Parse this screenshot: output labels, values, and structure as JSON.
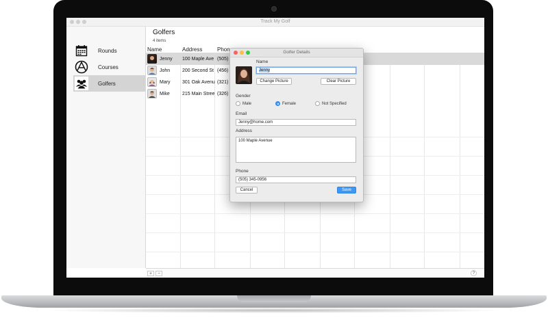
{
  "window": {
    "title": "Track My Golf"
  },
  "sidebar": {
    "items": [
      {
        "label": "Rounds",
        "icon": "calendar-icon",
        "selected": false
      },
      {
        "label": "Courses",
        "icon": "globe-icon",
        "selected": false
      },
      {
        "label": "Golfers",
        "icon": "people-icon",
        "selected": true
      }
    ]
  },
  "main": {
    "title": "Golfers",
    "subtitle": "4 items",
    "columns": [
      "Name",
      "Address",
      "Phon"
    ],
    "rows": [
      {
        "name": "Jenny",
        "address": "100 Maple Ave",
        "phone": "(505)",
        "selected": true
      },
      {
        "name": "John",
        "address": "200 Second St",
        "phone": "(456)",
        "selected": false
      },
      {
        "name": "Mary",
        "address": "301 Oak Avenu",
        "phone": "(321)",
        "selected": false
      },
      {
        "name": "Mike",
        "address": "215 Main Stree",
        "phone": "(326)",
        "selected": false
      }
    ],
    "add_button": "+",
    "remove_button": "−",
    "help_button": "?"
  },
  "dialog": {
    "title": "Golfer Details",
    "name_label": "Name",
    "name_value": "Jenny",
    "change_picture": "Change Picture",
    "clear_picture": "Clear Picture",
    "gender_label": "Gender",
    "gender_options": [
      "Male",
      "Female",
      "Not Specified"
    ],
    "gender_selected": "Female",
    "email_label": "Email",
    "email_value": "Jenny@home.com",
    "address_label": "Address",
    "address_value": "100 Maple Avenue",
    "phone_label": "Phone",
    "phone_value": "(505) 345-0956",
    "cancel": "Cancel",
    "save": "Save"
  },
  "colors": {
    "accent": "#3f97f5",
    "close": "#fc605c",
    "minimize": "#fdbc40",
    "zoom": "#34c84a"
  }
}
